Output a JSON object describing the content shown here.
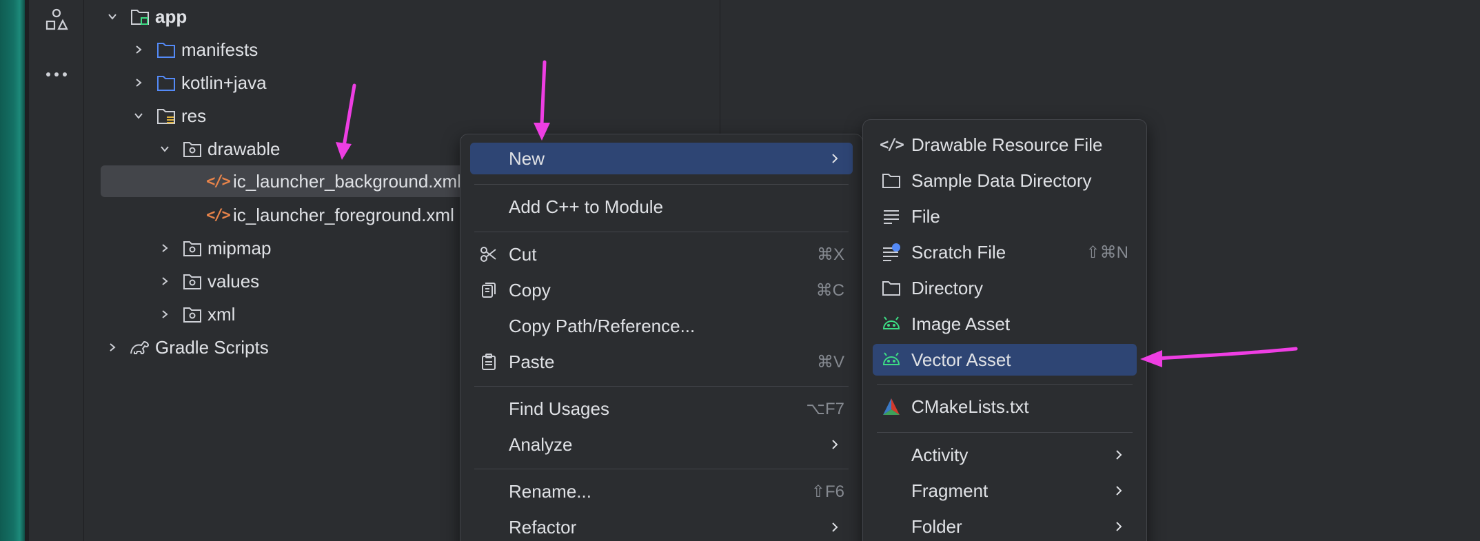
{
  "tree": {
    "items": [
      {
        "label": "app",
        "bold": true
      },
      {
        "label": "manifests"
      },
      {
        "label": "kotlin+java"
      },
      {
        "label": "res"
      },
      {
        "label": "drawable"
      },
      {
        "label": "ic_launcher_background.xml"
      },
      {
        "label": "ic_launcher_foreground.xml"
      },
      {
        "label": "mipmap"
      },
      {
        "label": "values"
      },
      {
        "label": "xml"
      },
      {
        "label": "Gradle Scripts"
      }
    ]
  },
  "context_menu": {
    "items": [
      {
        "label": "New",
        "submenu": true,
        "highlighted": true
      },
      {
        "label": "Add C++ to Module"
      },
      {
        "label": "Cut",
        "shortcut": "⌘X",
        "icon": "scissors-icon"
      },
      {
        "label": "Copy",
        "shortcut": "⌘C",
        "icon": "copy-icon"
      },
      {
        "label": "Copy Path/Reference..."
      },
      {
        "label": "Paste",
        "shortcut": "⌘V",
        "icon": "paste-icon"
      },
      {
        "label": "Find Usages",
        "shortcut": "⌥F7"
      },
      {
        "label": "Analyze",
        "submenu": true
      },
      {
        "label": "Rename...",
        "shortcut": "⇧F6"
      },
      {
        "label": "Refactor",
        "submenu": true
      }
    ]
  },
  "new_submenu": {
    "items": [
      {
        "label": "Drawable Resource File",
        "icon": "xml-file-icon"
      },
      {
        "label": "Sample Data Directory",
        "icon": "folder-icon"
      },
      {
        "label": "File",
        "icon": "text-file-icon"
      },
      {
        "label": "Scratch File",
        "shortcut": "⇧⌘N",
        "icon": "scratch-file-icon"
      },
      {
        "label": "Directory",
        "icon": "folder-icon"
      },
      {
        "label": "Image Asset",
        "icon": "android-icon"
      },
      {
        "label": "Vector Asset",
        "icon": "android-icon",
        "highlighted": true
      },
      {
        "label": "CMakeLists.txt",
        "icon": "cmake-icon"
      },
      {
        "label": "Activity",
        "submenu": true
      },
      {
        "label": "Fragment",
        "submenu": true
      },
      {
        "label": "Folder",
        "submenu": true
      }
    ]
  },
  "colors": {
    "highlight": "#2e4574",
    "annotation_arrow": "#ee3ee3",
    "folder_blue": "#548af7",
    "xml_orange": "#e8844a",
    "android_green": "#3ddc84"
  }
}
